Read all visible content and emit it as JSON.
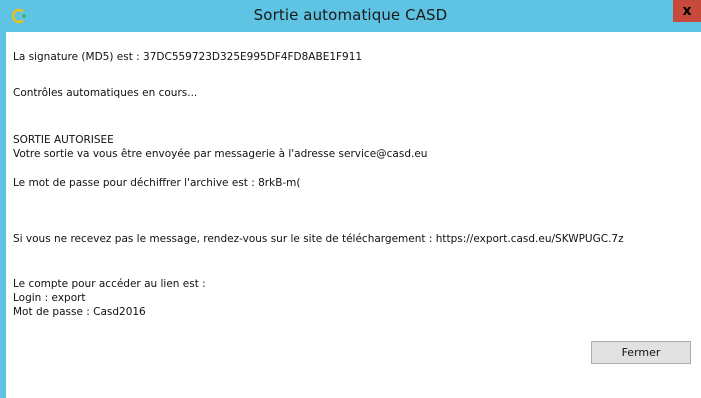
{
  "window": {
    "title": "Sortie automatique CASD",
    "close_label": "x",
    "accent_color": "#5fc3e4",
    "close_color": "#c74a3c",
    "app_icon": "casd-logo-icon"
  },
  "message": {
    "signature": "La signature (MD5) est : 37DC559723D325E995DF4FD8ABE1F911",
    "checks": "Contrôles automatiques en cours...",
    "status": "SORTIE AUTORISEE",
    "mail": "Votre sortie va vous être envoyée par messagerie  à l'adresse service@casd.eu",
    "password": "Le mot de passe pour déchiffrer l'archive est  : 8rkB-m(",
    "download": "Si vous ne recevez pas le message, rendez-vous sur le site de téléchargement : https://export.casd.eu/SKWPUGC.7z",
    "account": "Le compte pour accéder au lien est :",
    "login": "Login : export",
    "account_password": "Mot de passe : Casd2016"
  },
  "buttons": {
    "close_label": "Fermer"
  }
}
